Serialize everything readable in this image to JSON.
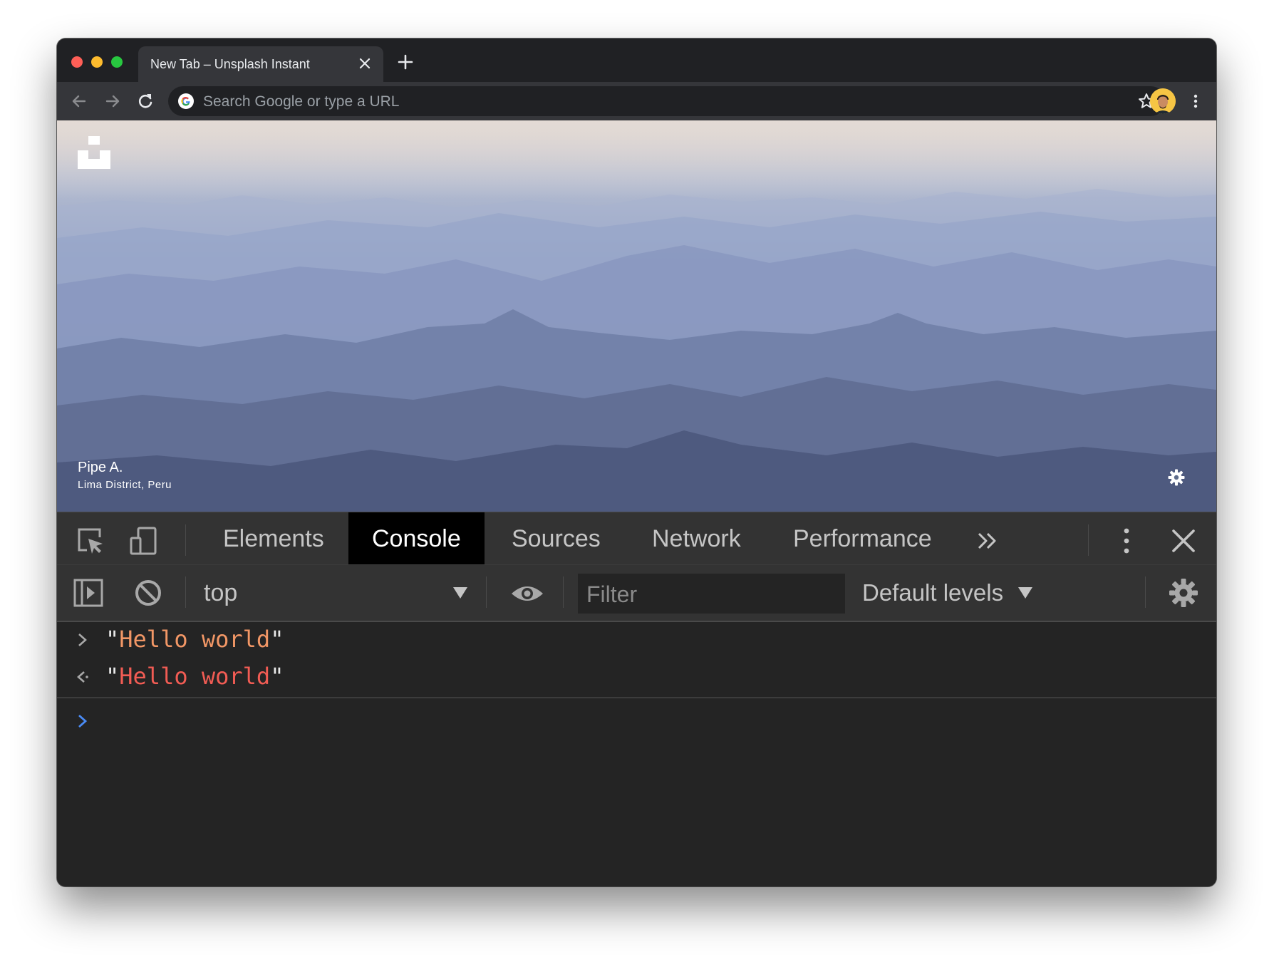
{
  "browser": {
    "tab_title": "New Tab – Unsplash Instant",
    "omnibox_placeholder": "Search Google or type a URL"
  },
  "page": {
    "photo_author": "Pipe A.",
    "photo_location": "Lima District, Peru"
  },
  "devtools": {
    "tabs": [
      "Elements",
      "Console",
      "Sources",
      "Network",
      "Performance"
    ],
    "active_tab": "Console",
    "context": "top",
    "filter_placeholder": "Filter",
    "levels_label": "Default levels",
    "console": {
      "input_text": "Hello world",
      "output_text": "Hello world",
      "input_color": "#f29766",
      "output_color": "#f25c54",
      "prompt_color": "#4a8bf5"
    }
  },
  "colors": {
    "window_bg": "#242424",
    "toolbar_bg": "#35363a",
    "devtools_bar_bg": "#333333"
  }
}
